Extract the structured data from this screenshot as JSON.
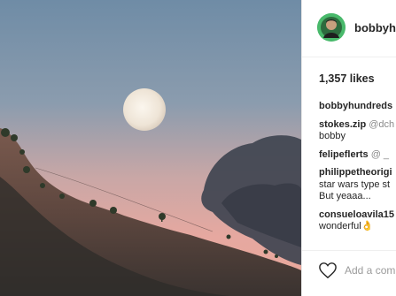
{
  "post": {
    "username": "bobbyhu",
    "likes": "1,357 likes",
    "add_comment_placeholder": "Add a comm"
  },
  "comments": [
    {
      "user": "bobbyhundreds",
      "mention": "",
      "text": ""
    },
    {
      "user": "stokes.zip",
      "mention": "@dch",
      "text": "bobby"
    },
    {
      "user": "felipeflerts",
      "mention": "@ _",
      "text": ""
    },
    {
      "user": "philippetheorigi",
      "mention": "",
      "text": "star wars type st",
      "text2": "But yeaaa..."
    },
    {
      "user": "consueloavila15",
      "mention": "",
      "text": "wonderful👌"
    }
  ],
  "icons": {
    "like": "heart-outline-icon",
    "avatar": "profile-avatar"
  },
  "colors": {
    "avatar_bg": "#49b96b",
    "text": "#262626",
    "muted": "#9b9b9b"
  }
}
